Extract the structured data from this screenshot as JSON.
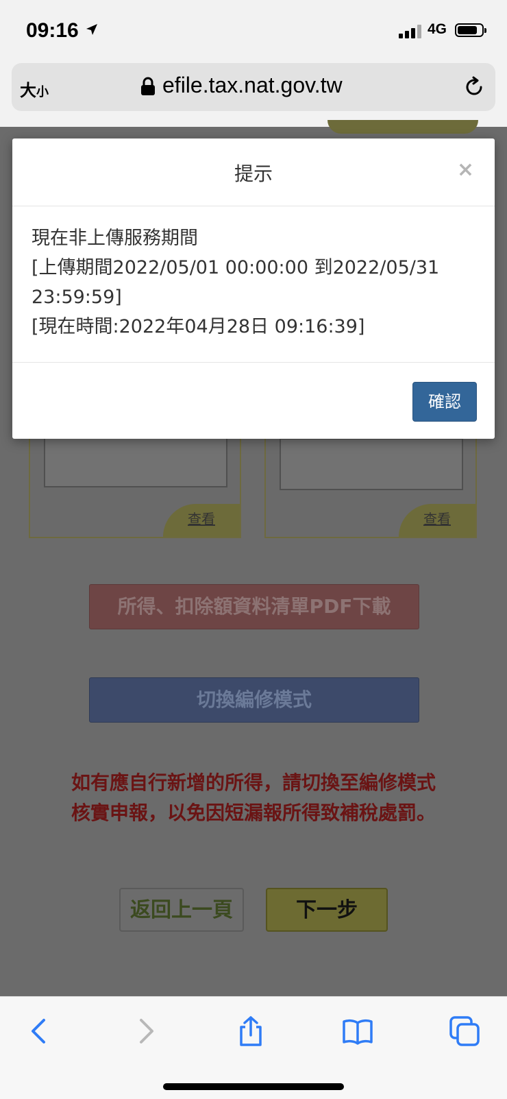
{
  "status": {
    "time": "09:16",
    "network": "4G",
    "location_icon": "location-arrow-icon",
    "signal_icon": "signal-icon",
    "battery_icon": "battery-icon"
  },
  "browser": {
    "text_size_label_big": "大",
    "text_size_label_small": "小",
    "url": "efile.tax.nat.gov.tw",
    "lock_icon": "lock-icon",
    "reload_icon": "reload-icon"
  },
  "page": {
    "card_view_label": "查看",
    "pdf_button": "所得、扣除額資料清單PDF下載",
    "switch_button": "切換編修模式",
    "warning_line1": "如有應自行新增的所得，請切換至編修模式",
    "warning_line2": "核實申報，以免因短漏報所得致補稅處罰。",
    "back_button": "返回上一頁",
    "next_button": "下一步"
  },
  "modal": {
    "title": "提示",
    "close": "×",
    "line1": "現在非上傳服務期間",
    "line2": "[上傳期間2022/05/01 00:00:00 到2022/05/31 23:59:59]",
    "line3": "[現在時間:2022年04月28日 09:16:39]",
    "confirm_button": "確認"
  },
  "toolbar": {
    "icons": [
      "back-arrow-icon",
      "forward-arrow-icon",
      "share-icon",
      "bookmarks-icon",
      "tabs-icon"
    ]
  },
  "colors": {
    "modal_confirm": "#336699",
    "overlay": "#6b6b6b",
    "ios_blue": "#2f7cf6"
  }
}
